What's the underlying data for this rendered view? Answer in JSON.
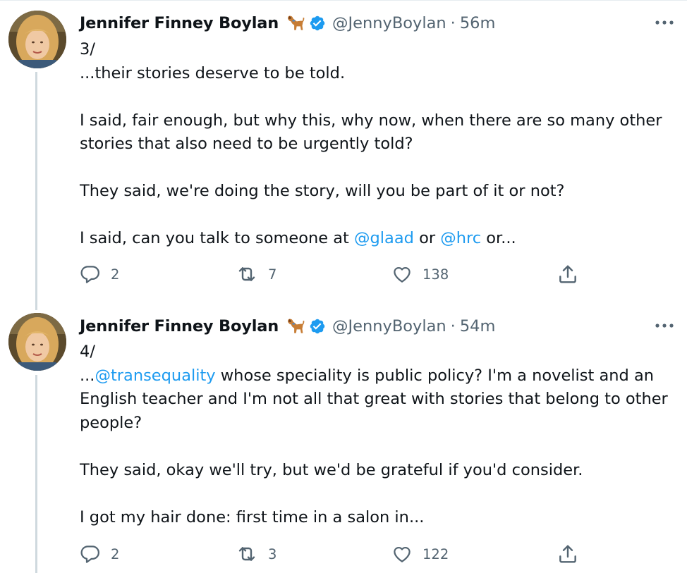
{
  "tweets": [
    {
      "author_name": "Jennifer Finney Boylan",
      "name_emoji": "dog-emoji",
      "verified_icon": "verified-badge-icon",
      "handle": "@JennyBoylan",
      "separator": "·",
      "time": "56m",
      "thread_number": "3/",
      "paragraphs": [
        {
          "lines": [
            {
              "segments": [
                {
                  "text": "...their stories deserve to be told."
                }
              ]
            }
          ]
        },
        {
          "lines": [
            {
              "segments": [
                {
                  "text": "I said, fair enough, but why this, why now, when there are so many other"
                }
              ]
            },
            {
              "segments": [
                {
                  "text": "stories that also need to be urgently told?"
                }
              ]
            }
          ]
        },
        {
          "lines": [
            {
              "segments": [
                {
                  "text": "They said, we're doing the story, will you be part of it or not?"
                }
              ]
            }
          ]
        },
        {
          "lines": [
            {
              "segments": [
                {
                  "text": "I said, can you talk to someone at "
                },
                {
                  "text": "@glaad",
                  "mention": true
                },
                {
                  "text": " or "
                },
                {
                  "text": "@hrc",
                  "mention": true
                },
                {
                  "text": " or..."
                }
              ]
            }
          ]
        }
      ],
      "reply_count": "2",
      "retweet_count": "7",
      "like_count": "138"
    },
    {
      "author_name": "Jennifer Finney Boylan",
      "name_emoji": "dog-emoji",
      "verified_icon": "verified-badge-icon",
      "handle": "@JennyBoylan",
      "separator": "·",
      "time": "54m",
      "thread_number": "4/",
      "paragraphs": [
        {
          "lines": [
            {
              "segments": [
                {
                  "text": "..."
                },
                {
                  "text": "@transequality",
                  "mention": true
                },
                {
                  "text": " whose speciality is public policy? I'm a novelist and an"
                }
              ]
            },
            {
              "segments": [
                {
                  "text": "English teacher and I'm not all that great with stories that belong to other"
                }
              ]
            },
            {
              "segments": [
                {
                  "text": "people?"
                }
              ]
            }
          ]
        },
        {
          "lines": [
            {
              "segments": [
                {
                  "text": "They said, okay we'll try, but we'd be grateful if you'd consider."
                }
              ]
            }
          ]
        },
        {
          "lines": [
            {
              "segments": [
                {
                  "text": "I got my hair done: first time in a salon in..."
                }
              ]
            }
          ]
        }
      ],
      "reply_count": "2",
      "retweet_count": "3",
      "like_count": "122"
    }
  ],
  "colors": {
    "text": "#0f1419",
    "secondary": "#536471",
    "mention": "#1d9bf0",
    "verified": "#1d9bf0",
    "thread_line": "#cfd9de"
  },
  "icons": [
    "more-options-icon",
    "reply-icon",
    "retweet-icon",
    "like-icon",
    "share-icon"
  ]
}
